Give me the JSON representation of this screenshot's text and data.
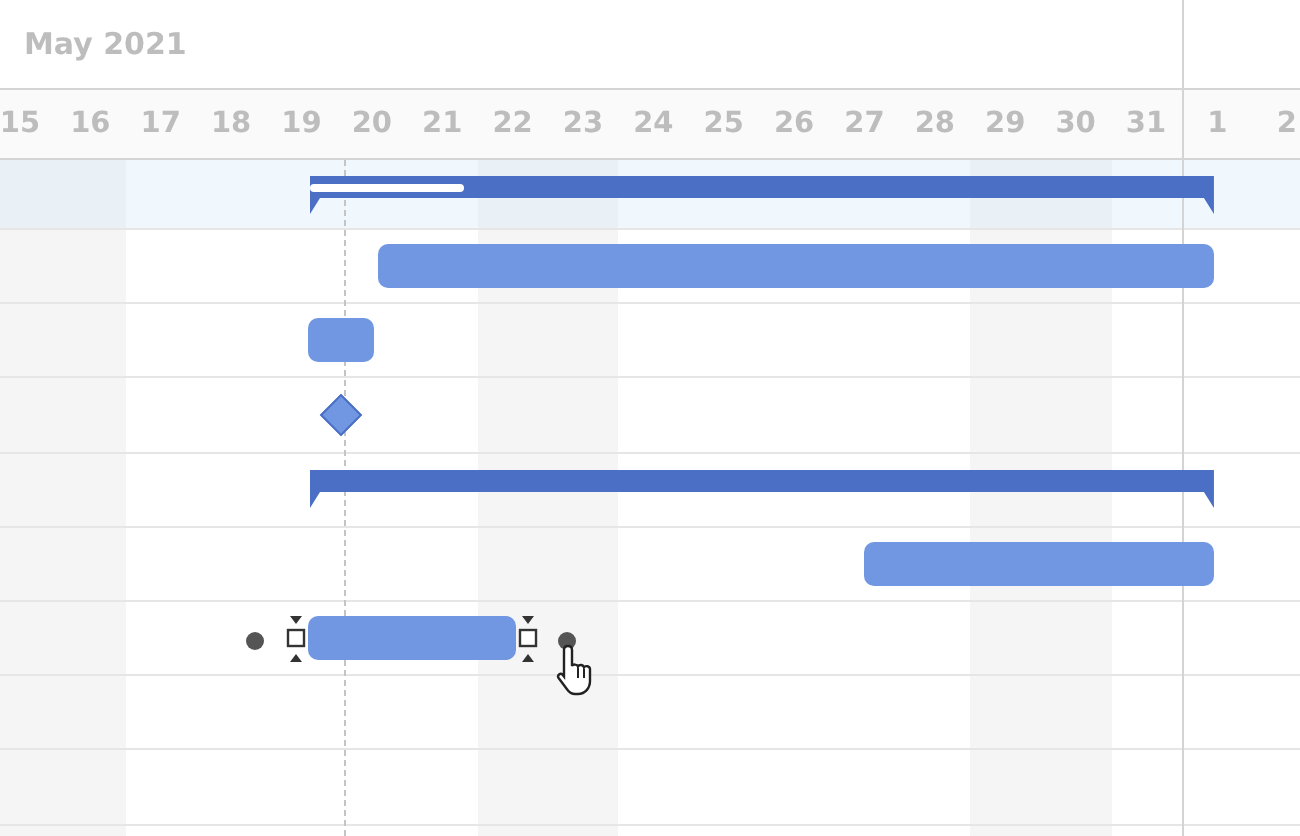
{
  "header": {
    "month": "May 2021"
  },
  "days": [
    {
      "label": "15",
      "month_start": false
    },
    {
      "label": "16",
      "month_start": false
    },
    {
      "label": "17",
      "month_start": false
    },
    {
      "label": "18",
      "month_start": false
    },
    {
      "label": "19",
      "month_start": false
    },
    {
      "label": "20",
      "month_start": false
    },
    {
      "label": "21",
      "month_start": false
    },
    {
      "label": "22",
      "month_start": false
    },
    {
      "label": "23",
      "month_start": false
    },
    {
      "label": "24",
      "month_start": false
    },
    {
      "label": "25",
      "month_start": false
    },
    {
      "label": "26",
      "month_start": false
    },
    {
      "label": "27",
      "month_start": false
    },
    {
      "label": "28",
      "month_start": false
    },
    {
      "label": "29",
      "month_start": false
    },
    {
      "label": "30",
      "month_start": false
    },
    {
      "label": "31",
      "month_start": false
    },
    {
      "label": "1",
      "month_start": true
    },
    {
      "label": "2",
      "month_start": false
    }
  ],
  "rows": [
    {
      "selected": true,
      "task": {
        "kind": "summary",
        "level": 0.17,
        "selected": false
      }
    },
    {
      "selected": false,
      "task": {
        "kind": "task",
        "selected": false
      }
    },
    {
      "selected": false,
      "task": {
        "kind": "task",
        "selected": false
      }
    },
    {
      "selected": false,
      "task": {
        "kind": "milestone",
        "selected": false
      }
    },
    {
      "selected": false,
      "task": {
        "kind": "summary",
        "selected": false
      }
    },
    {
      "selected": false,
      "task": {
        "kind": "task",
        "selected": false
      }
    },
    {
      "selected": false,
      "task": {
        "kind": "task",
        "selected": true
      }
    },
    {
      "selected": false
    },
    {
      "selected": false
    },
    {
      "selected": false
    }
  ]
}
